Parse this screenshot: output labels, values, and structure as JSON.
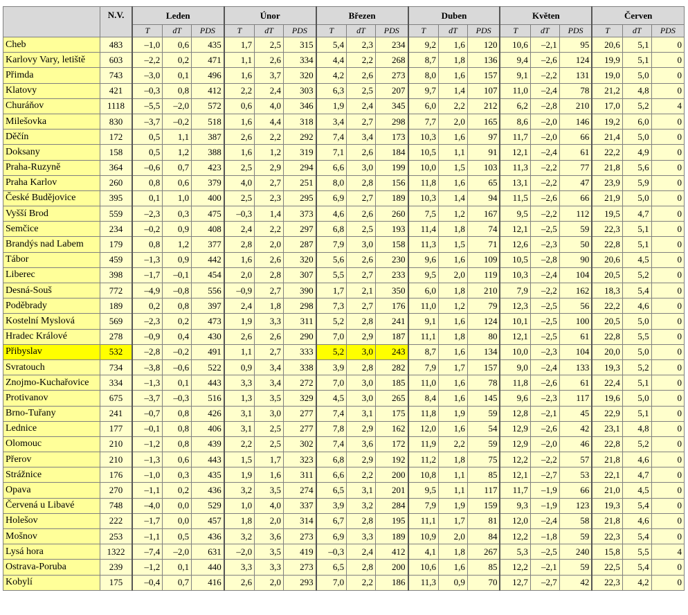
{
  "header": {
    "nv_label": "N.V.",
    "months": [
      "Leden",
      "Únor",
      "Březen",
      "Duben",
      "Květen",
      "Červen"
    ],
    "subcols": [
      "T",
      "dT",
      "PDS"
    ]
  },
  "highlight": {
    "row_station": "Přibyslav",
    "month_index": 2
  },
  "colors": {
    "header_bg": "#d9d9d9",
    "station_bg": "#ffff99",
    "cell_bg": "#ffffcc",
    "highlight": "#ffff00"
  },
  "rows": [
    {
      "station": "Cheb",
      "nv": "483",
      "m": [
        [
          "–1,0",
          "0,6",
          "435"
        ],
        [
          "1,7",
          "2,5",
          "315"
        ],
        [
          "5,4",
          "2,3",
          "234"
        ],
        [
          "9,2",
          "1,6",
          "120"
        ],
        [
          "10,6",
          "–2,1",
          "95"
        ],
        [
          "20,6",
          "5,1",
          "0"
        ]
      ]
    },
    {
      "station": "Karlovy Vary, letiště",
      "nv": "603",
      "m": [
        [
          "–2,2",
          "0,2",
          "471"
        ],
        [
          "1,1",
          "2,6",
          "334"
        ],
        [
          "4,4",
          "2,2",
          "268"
        ],
        [
          "8,7",
          "1,8",
          "136"
        ],
        [
          "9,4",
          "–2,6",
          "124"
        ],
        [
          "19,9",
          "5,1",
          "0"
        ]
      ]
    },
    {
      "station": "Přimda",
      "nv": "743",
      "m": [
        [
          "–3,0",
          "0,1",
          "496"
        ],
        [
          "1,6",
          "3,7",
          "320"
        ],
        [
          "4,2",
          "2,6",
          "273"
        ],
        [
          "8,0",
          "1,6",
          "157"
        ],
        [
          "9,1",
          "–2,2",
          "131"
        ],
        [
          "19,0",
          "5,0",
          "0"
        ]
      ]
    },
    {
      "station": "Klatovy",
      "nv": "421",
      "m": [
        [
          "–0,3",
          "0,8",
          "412"
        ],
        [
          "2,2",
          "2,4",
          "303"
        ],
        [
          "6,3",
          "2,5",
          "207"
        ],
        [
          "9,7",
          "1,4",
          "107"
        ],
        [
          "11,0",
          "–2,4",
          "78"
        ],
        [
          "21,2",
          "4,8",
          "0"
        ]
      ]
    },
    {
      "station": "Churáňov",
      "nv": "1118",
      "m": [
        [
          "–5,5",
          "–2,0",
          "572"
        ],
        [
          "0,6",
          "4,0",
          "346"
        ],
        [
          "1,9",
          "2,4",
          "345"
        ],
        [
          "6,0",
          "2,2",
          "212"
        ],
        [
          "6,2",
          "–2,8",
          "210"
        ],
        [
          "17,0",
          "5,2",
          "4"
        ]
      ]
    },
    {
      "station": "Milešovka",
      "nv": "830",
      "m": [
        [
          "–3,7",
          "–0,2",
          "518"
        ],
        [
          "1,6",
          "4,4",
          "318"
        ],
        [
          "3,4",
          "2,7",
          "298"
        ],
        [
          "7,7",
          "2,0",
          "165"
        ],
        [
          "8,6",
          "–2,0",
          "146"
        ],
        [
          "19,2",
          "6,0",
          "0"
        ]
      ]
    },
    {
      "station": "Děčín",
      "nv": "172",
      "m": [
        [
          "0,5",
          "1,1",
          "387"
        ],
        [
          "2,6",
          "2,2",
          "292"
        ],
        [
          "7,4",
          "3,4",
          "173"
        ],
        [
          "10,3",
          "1,6",
          "97"
        ],
        [
          "11,7",
          "–2,0",
          "66"
        ],
        [
          "21,4",
          "5,0",
          "0"
        ]
      ]
    },
    {
      "station": "Doksany",
      "nv": "158",
      "m": [
        [
          "0,5",
          "1,2",
          "388"
        ],
        [
          "1,6",
          "1,2",
          "319"
        ],
        [
          "7,1",
          "2,6",
          "184"
        ],
        [
          "10,5",
          "1,1",
          "91"
        ],
        [
          "12,1",
          "–2,4",
          "61"
        ],
        [
          "22,2",
          "4,9",
          "0"
        ]
      ]
    },
    {
      "station": "Praha-Ruzyně",
      "nv": "364",
      "m": [
        [
          "–0,6",
          "0,7",
          "423"
        ],
        [
          "2,5",
          "2,9",
          "294"
        ],
        [
          "6,6",
          "3,0",
          "199"
        ],
        [
          "10,0",
          "1,5",
          "103"
        ],
        [
          "11,3",
          "–2,2",
          "77"
        ],
        [
          "21,8",
          "5,6",
          "0"
        ]
      ]
    },
    {
      "station": "Praha Karlov",
      "nv": "260",
      "m": [
        [
          "0,8",
          "0,6",
          "379"
        ],
        [
          "4,0",
          "2,7",
          "251"
        ],
        [
          "8,0",
          "2,8",
          "156"
        ],
        [
          "11,8",
          "1,6",
          "65"
        ],
        [
          "13,1",
          "–2,2",
          "47"
        ],
        [
          "23,9",
          "5,9",
          "0"
        ]
      ]
    },
    {
      "station": "České Budějovice",
      "nv": "395",
      "m": [
        [
          "0,1",
          "1,0",
          "400"
        ],
        [
          "2,5",
          "2,3",
          "295"
        ],
        [
          "6,9",
          "2,7",
          "189"
        ],
        [
          "10,3",
          "1,4",
          "94"
        ],
        [
          "11,5",
          "–2,6",
          "66"
        ],
        [
          "21,9",
          "5,0",
          "0"
        ]
      ]
    },
    {
      "station": "Vyšší Brod",
      "nv": "559",
      "m": [
        [
          "–2,3",
          "0,3",
          "475"
        ],
        [
          "–0,3",
          "1,4",
          "373"
        ],
        [
          "4,6",
          "2,6",
          "260"
        ],
        [
          "7,5",
          "1,2",
          "167"
        ],
        [
          "9,5",
          "–2,2",
          "112"
        ],
        [
          "19,5",
          "4,7",
          "0"
        ]
      ]
    },
    {
      "station": "Semčice",
      "nv": "234",
      "m": [
        [
          "–0,2",
          "0,9",
          "408"
        ],
        [
          "2,4",
          "2,2",
          "297"
        ],
        [
          "6,8",
          "2,5",
          "193"
        ],
        [
          "11,4",
          "1,8",
          "74"
        ],
        [
          "12,1",
          "–2,5",
          "59"
        ],
        [
          "22,3",
          "5,1",
          "0"
        ]
      ]
    },
    {
      "station": "Brandýs nad Labem",
      "nv": "179",
      "m": [
        [
          "0,8",
          "1,2",
          "377"
        ],
        [
          "2,8",
          "2,0",
          "287"
        ],
        [
          "7,9",
          "3,0",
          "158"
        ],
        [
          "11,3",
          "1,5",
          "71"
        ],
        [
          "12,6",
          "–2,3",
          "50"
        ],
        [
          "22,8",
          "5,1",
          "0"
        ]
      ]
    },
    {
      "station": "Tábor",
      "nv": "459",
      "m": [
        [
          "–1,3",
          "0,9",
          "442"
        ],
        [
          "1,6",
          "2,6",
          "320"
        ],
        [
          "5,6",
          "2,6",
          "230"
        ],
        [
          "9,6",
          "1,6",
          "109"
        ],
        [
          "10,5",
          "–2,8",
          "90"
        ],
        [
          "20,6",
          "4,5",
          "0"
        ]
      ]
    },
    {
      "station": "Liberec",
      "nv": "398",
      "m": [
        [
          "–1,7",
          "–0,1",
          "454"
        ],
        [
          "2,0",
          "2,8",
          "307"
        ],
        [
          "5,5",
          "2,7",
          "233"
        ],
        [
          "9,5",
          "2,0",
          "119"
        ],
        [
          "10,3",
          "–2,4",
          "104"
        ],
        [
          "20,5",
          "5,2",
          "0"
        ]
      ]
    },
    {
      "station": "Desná-Souš",
      "nv": "772",
      "m": [
        [
          "–4,9",
          "–0,8",
          "556"
        ],
        [
          "–0,9",
          "2,7",
          "390"
        ],
        [
          "1,7",
          "2,1",
          "350"
        ],
        [
          "6,0",
          "1,8",
          "210"
        ],
        [
          "7,9",
          "–2,2",
          "162"
        ],
        [
          "18,3",
          "5,4",
          "0"
        ]
      ]
    },
    {
      "station": "Poděbrady",
      "nv": "189",
      "m": [
        [
          "0,2",
          "0,8",
          "397"
        ],
        [
          "2,4",
          "1,8",
          "298"
        ],
        [
          "7,3",
          "2,7",
          "176"
        ],
        [
          "11,0",
          "1,2",
          "79"
        ],
        [
          "12,3",
          "–2,5",
          "56"
        ],
        [
          "22,2",
          "4,6",
          "0"
        ]
      ]
    },
    {
      "station": "Kostelní Myslová",
      "nv": "569",
      "m": [
        [
          "–2,3",
          "0,2",
          "473"
        ],
        [
          "1,9",
          "3,3",
          "311"
        ],
        [
          "5,2",
          "2,8",
          "241"
        ],
        [
          "9,1",
          "1,6",
          "124"
        ],
        [
          "10,1",
          "–2,5",
          "100"
        ],
        [
          "20,5",
          "5,0",
          "0"
        ]
      ]
    },
    {
      "station": "Hradec Králové",
      "nv": "278",
      "m": [
        [
          "–0,9",
          "0,4",
          "430"
        ],
        [
          "2,6",
          "2,6",
          "290"
        ],
        [
          "7,0",
          "2,9",
          "187"
        ],
        [
          "11,1",
          "1,8",
          "80"
        ],
        [
          "12,1",
          "–2,5",
          "61"
        ],
        [
          "22,8",
          "5,5",
          "0"
        ]
      ]
    },
    {
      "station": "Přibyslav",
      "nv": "532",
      "m": [
        [
          "–2,8",
          "–0,2",
          "491"
        ],
        [
          "1,1",
          "2,7",
          "333"
        ],
        [
          "5,2",
          "3,0",
          "243"
        ],
        [
          "8,7",
          "1,6",
          "134"
        ],
        [
          "10,0",
          "–2,3",
          "104"
        ],
        [
          "20,0",
          "5,0",
          "0"
        ]
      ]
    },
    {
      "station": "Svratouch",
      "nv": "734",
      "m": [
        [
          "–3,8",
          "–0,6",
          "522"
        ],
        [
          "0,9",
          "3,4",
          "338"
        ],
        [
          "3,9",
          "2,8",
          "282"
        ],
        [
          "7,9",
          "1,7",
          "157"
        ],
        [
          "9,0",
          "–2,4",
          "133"
        ],
        [
          "19,3",
          "5,2",
          "0"
        ]
      ]
    },
    {
      "station": "Znojmo-Kuchařovice",
      "nv": "334",
      "m": [
        [
          "–1,3",
          "0,1",
          "443"
        ],
        [
          "3,3",
          "3,4",
          "272"
        ],
        [
          "7,0",
          "3,0",
          "185"
        ],
        [
          "11,0",
          "1,6",
          "78"
        ],
        [
          "11,8",
          "–2,6",
          "61"
        ],
        [
          "22,4",
          "5,1",
          "0"
        ]
      ]
    },
    {
      "station": "Protivanov",
      "nv": "675",
      "m": [
        [
          "–3,7",
          "–0,3",
          "516"
        ],
        [
          "1,3",
          "3,5",
          "329"
        ],
        [
          "4,5",
          "3,0",
          "265"
        ],
        [
          "8,4",
          "1,6",
          "145"
        ],
        [
          "9,6",
          "–2,3",
          "117"
        ],
        [
          "19,6",
          "5,0",
          "0"
        ]
      ]
    },
    {
      "station": "Brno-Tuřany",
      "nv": "241",
      "m": [
        [
          "–0,7",
          "0,8",
          "426"
        ],
        [
          "3,1",
          "3,0",
          "277"
        ],
        [
          "7,4",
          "3,1",
          "175"
        ],
        [
          "11,8",
          "1,9",
          "59"
        ],
        [
          "12,8",
          "–2,1",
          "45"
        ],
        [
          "22,9",
          "5,1",
          "0"
        ]
      ]
    },
    {
      "station": "Lednice",
      "nv": "177",
      "m": [
        [
          "–0,1",
          "0,8",
          "406"
        ],
        [
          "3,1",
          "2,5",
          "277"
        ],
        [
          "7,8",
          "2,9",
          "162"
        ],
        [
          "12,0",
          "1,6",
          "54"
        ],
        [
          "12,9",
          "–2,6",
          "42"
        ],
        [
          "23,1",
          "4,8",
          "0"
        ]
      ]
    },
    {
      "station": "Olomouc",
      "nv": "210",
      "m": [
        [
          "–1,2",
          "0,8",
          "439"
        ],
        [
          "2,2",
          "2,5",
          "302"
        ],
        [
          "7,4",
          "3,6",
          "172"
        ],
        [
          "11,9",
          "2,2",
          "59"
        ],
        [
          "12,9",
          "–2,0",
          "46"
        ],
        [
          "22,8",
          "5,2",
          "0"
        ]
      ]
    },
    {
      "station": "Přerov",
      "nv": "210",
      "m": [
        [
          "–1,3",
          "0,6",
          "443"
        ],
        [
          "1,5",
          "1,7",
          "323"
        ],
        [
          "6,8",
          "2,9",
          "192"
        ],
        [
          "11,2",
          "1,8",
          "75"
        ],
        [
          "12,2",
          "–2,2",
          "57"
        ],
        [
          "21,8",
          "4,6",
          "0"
        ]
      ]
    },
    {
      "station": "Strážnice",
      "nv": "176",
      "m": [
        [
          "–1,0",
          "0,3",
          "435"
        ],
        [
          "1,9",
          "1,6",
          "311"
        ],
        [
          "6,6",
          "2,2",
          "200"
        ],
        [
          "10,8",
          "1,1",
          "85"
        ],
        [
          "12,1",
          "–2,7",
          "53"
        ],
        [
          "22,1",
          "4,7",
          "0"
        ]
      ]
    },
    {
      "station": "Opava",
      "nv": "270",
      "m": [
        [
          "–1,1",
          "0,2",
          "436"
        ],
        [
          "3,2",
          "3,5",
          "274"
        ],
        [
          "6,5",
          "3,1",
          "201"
        ],
        [
          "9,5",
          "1,1",
          "117"
        ],
        [
          "11,7",
          "–1,9",
          "66"
        ],
        [
          "21,0",
          "4,5",
          "0"
        ]
      ]
    },
    {
      "station": "Červená u Libavé",
      "nv": "748",
      "m": [
        [
          "–4,0",
          "0,0",
          "529"
        ],
        [
          "1,0",
          "4,0",
          "337"
        ],
        [
          "3,9",
          "3,2",
          "284"
        ],
        [
          "7,9",
          "1,9",
          "159"
        ],
        [
          "9,3",
          "–1,9",
          "123"
        ],
        [
          "19,3",
          "5,4",
          "0"
        ]
      ]
    },
    {
      "station": "Holešov",
      "nv": "222",
      "m": [
        [
          "–1,7",
          "0,0",
          "457"
        ],
        [
          "1,8",
          "2,0",
          "314"
        ],
        [
          "6,7",
          "2,8",
          "195"
        ],
        [
          "11,1",
          "1,7",
          "81"
        ],
        [
          "12,0",
          "–2,4",
          "58"
        ],
        [
          "21,8",
          "4,6",
          "0"
        ]
      ]
    },
    {
      "station": "Mošnov",
      "nv": "253",
      "m": [
        [
          "–1,1",
          "0,5",
          "436"
        ],
        [
          "3,2",
          "3,6",
          "273"
        ],
        [
          "6,9",
          "3,3",
          "189"
        ],
        [
          "10,9",
          "2,0",
          "84"
        ],
        [
          "12,2",
          "–1,8",
          "59"
        ],
        [
          "22,3",
          "5,4",
          "0"
        ]
      ]
    },
    {
      "station": "Lysá hora",
      "nv": "1322",
      "m": [
        [
          "–7,4",
          "–2,0",
          "631"
        ],
        [
          "–2,0",
          "3,5",
          "419"
        ],
        [
          "–0,3",
          "2,4",
          "412"
        ],
        [
          "4,1",
          "1,8",
          "267"
        ],
        [
          "5,3",
          "–2,5",
          "240"
        ],
        [
          "15,8",
          "5,5",
          "4"
        ]
      ]
    },
    {
      "station": "Ostrava-Poruba",
      "nv": "239",
      "m": [
        [
          "–1,2",
          "0,1",
          "440"
        ],
        [
          "3,3",
          "3,3",
          "273"
        ],
        [
          "6,5",
          "2,8",
          "200"
        ],
        [
          "10,6",
          "1,6",
          "85"
        ],
        [
          "12,2",
          "–2,1",
          "59"
        ],
        [
          "22,5",
          "5,4",
          "0"
        ]
      ]
    },
    {
      "station": "Kobylí",
      "nv": "175",
      "m": [
        [
          "–0,4",
          "0,7",
          "416"
        ],
        [
          "2,6",
          "2,0",
          "293"
        ],
        [
          "7,0",
          "2,2",
          "186"
        ],
        [
          "11,3",
          "0,9",
          "70"
        ],
        [
          "12,7",
          "–2,7",
          "42"
        ],
        [
          "22,3",
          "4,2",
          "0"
        ]
      ]
    }
  ]
}
